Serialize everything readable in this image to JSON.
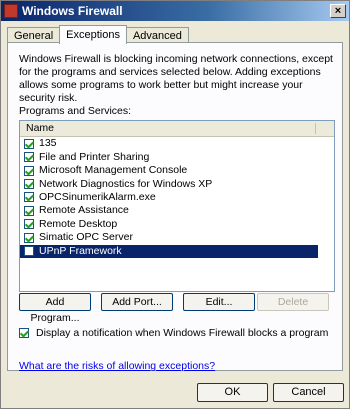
{
  "window": {
    "title": "Windows Firewall",
    "close_glyph": "×"
  },
  "tabs": [
    {
      "label": "General",
      "active": false
    },
    {
      "label": "Exceptions",
      "active": true
    },
    {
      "label": "Advanced",
      "active": false
    }
  ],
  "exceptions": {
    "description": "Windows Firewall is blocking incoming network connections, except for the programs and services selected below. Adding exceptions allows some programs to work better but might increase your security risk.",
    "list_label": "Programs and Services:",
    "column_header": "Name",
    "items": [
      {
        "label": "135",
        "checked": true
      },
      {
        "label": "File and Printer Sharing",
        "checked": true
      },
      {
        "label": "Microsoft Management Console",
        "checked": true
      },
      {
        "label": "Network Diagnostics for Windows XP",
        "checked": true
      },
      {
        "label": "OPCSinumerikAlarm.exe",
        "checked": true
      },
      {
        "label": "Remote Assistance",
        "checked": true
      },
      {
        "label": "Remote Desktop",
        "checked": true
      },
      {
        "label": "Simatic OPC Server",
        "checked": true
      },
      {
        "label": "UPnP Framework",
        "checked": false,
        "selected": true
      }
    ],
    "buttons": {
      "add_program": "Add Program...",
      "add_port": "Add Port...",
      "edit": "Edit...",
      "delete": "Delete"
    },
    "notify_label": "Display a notification when Windows Firewall blocks a program",
    "notify_checked": true,
    "risk_link": "What are the risks of allowing exceptions?"
  },
  "footer": {
    "ok": "OK",
    "cancel": "Cancel"
  }
}
